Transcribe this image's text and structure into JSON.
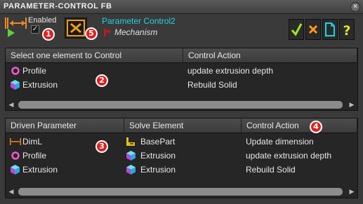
{
  "window": {
    "title": "PARAMETER-CONTROL FB",
    "close_glyph": "×"
  },
  "toolbar": {
    "enabled_label": "Enabled",
    "enabled_checked": true,
    "check_glyph": "✓",
    "parameter_name": "Parameter Control2",
    "parameter_type": "Mechanism",
    "badges": [
      "1",
      "5"
    ]
  },
  "top_table": {
    "badge": "2",
    "columns": [
      "Select one element to Control",
      "Control Action"
    ],
    "rows": [
      {
        "icon": "profile-icon",
        "element": "Profile",
        "action": "update extrusion depth"
      },
      {
        "icon": "extrusion-icon",
        "element": "Extrusion",
        "action": "Rebuild Solid"
      }
    ]
  },
  "bottom_table": {
    "badges": [
      "3",
      "4"
    ],
    "columns": [
      "Driven Parameter",
      "Solve Element",
      "Control Action"
    ],
    "rows": [
      {
        "param_icon": "dimension-icon",
        "param": "DimL",
        "solve_icon": "basepart-icon",
        "solve": "BasePart",
        "action": "Update dimension"
      },
      {
        "param_icon": "profile-icon",
        "param": "Profile",
        "solve_icon": "extrusion-icon",
        "solve": "Extrusion",
        "action": "update extrusion depth"
      },
      {
        "param_icon": "extrusion-icon",
        "param": "Extrusion",
        "solve_icon": "extrusion-icon",
        "solve": "Extrusion",
        "action": "Rebuild Solid"
      }
    ]
  },
  "colors": {
    "accent_cyan": "#22d3e0",
    "badge_red": "#e02020",
    "ok_green": "#9be81e",
    "cancel_orange": "#ff9a1a"
  }
}
